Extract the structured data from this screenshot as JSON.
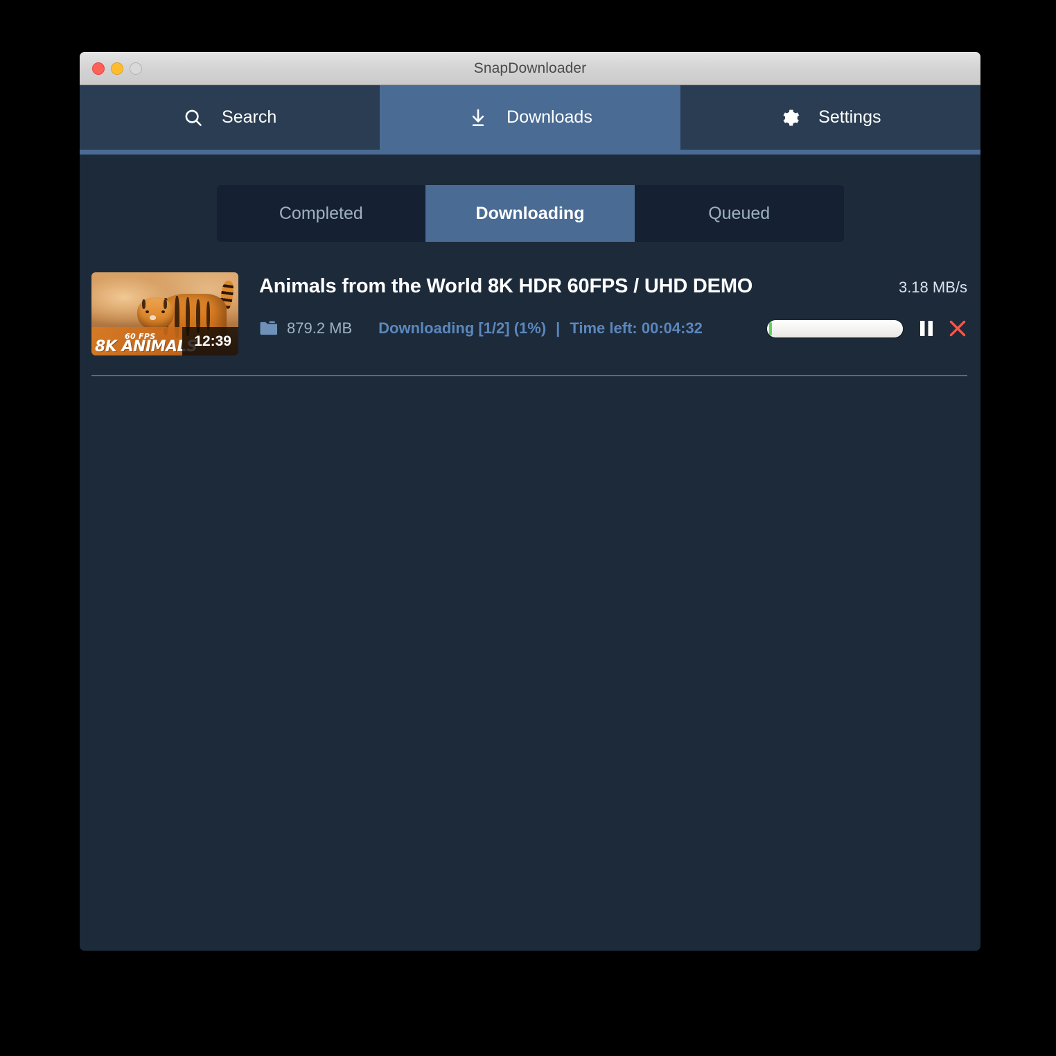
{
  "window": {
    "title": "SnapDownloader",
    "traffic_lights": [
      {
        "name": "close",
        "color": "#ff6058"
      },
      {
        "name": "minimize",
        "color": "#ffbd2e"
      },
      {
        "name": "zoom",
        "color": "#d9d9d9"
      }
    ]
  },
  "nav": {
    "items": [
      {
        "label": "Search",
        "icon": "search-icon",
        "active": false
      },
      {
        "label": "Downloads",
        "icon": "download-icon",
        "active": true
      },
      {
        "label": "Settings",
        "icon": "gear-icon",
        "active": false
      }
    ],
    "active_color": "#4a6b93",
    "inactive_color": "#2b3d52"
  },
  "tabs": {
    "items": [
      {
        "label": "Completed",
        "active": false
      },
      {
        "label": "Downloading",
        "active": true
      },
      {
        "label": "Queued",
        "active": false
      }
    ],
    "active_color": "#4a6b93",
    "track_color": "#152033"
  },
  "downloads": [
    {
      "title": "Animals from the World 8K HDR 60FPS / UHD DEMO",
      "speed": "3.18 MB/s",
      "size": "879.2 MB",
      "status": "Downloading [1/2] (1%)",
      "separator": "|",
      "time_left": "Time left: 00:04:32",
      "progress_percent": 1,
      "progress_fill_color": "#5ed45e",
      "thumbnail": {
        "duration": "12:39",
        "badge_title": "8K ANIMALS",
        "badge_fps": "60 FPS"
      },
      "actions": [
        {
          "name": "pause",
          "icon": "pause-icon",
          "color": "#ffffff"
        },
        {
          "name": "cancel",
          "icon": "close-x-icon",
          "color": "#f0584c"
        }
      ]
    }
  ],
  "colors": {
    "background": "#1d2a3a",
    "accent": "#4a6b93",
    "status_text": "#5b87bd",
    "muted_text": "#9fb2c6",
    "divider": "#4e6d92",
    "danger": "#f0584c",
    "success": "#5ed45e"
  }
}
